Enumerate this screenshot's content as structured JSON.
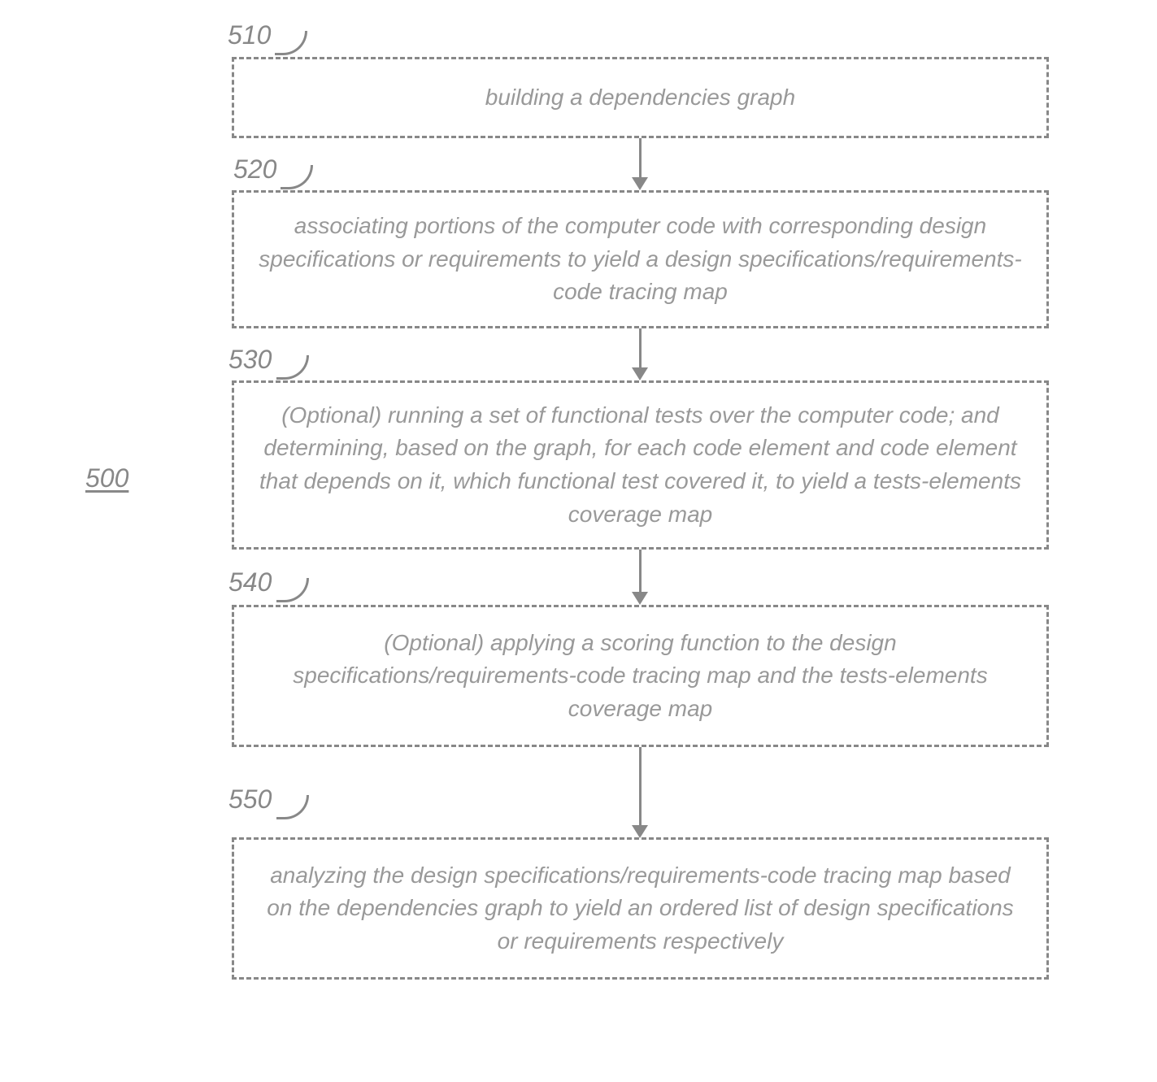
{
  "figure_label": "500",
  "steps": [
    {
      "num": "510",
      "text": "building a dependencies graph"
    },
    {
      "num": "520",
      "text": "associating portions of the computer code with corresponding design specifications or requirements to yield a design specifications/requirements-code tracing map"
    },
    {
      "num": "530",
      "text": "(Optional) running a set of functional tests over the computer code; and determining, based on the graph, for each code element and code element that depends on it, which functional test covered it, to yield a tests-elements coverage map"
    },
    {
      "num": "540",
      "text": "(Optional) applying a scoring function to the design specifications/requirements-code tracing map and the tests-elements coverage map"
    },
    {
      "num": "550",
      "text": "analyzing the design specifications/requirements-code tracing map based on the dependencies graph to yield an ordered list of design specifications or requirements respectively"
    }
  ],
  "chart_data": {
    "type": "flowchart",
    "direction": "top-to-bottom",
    "nodes": [
      {
        "id": "510",
        "label": "building a dependencies graph"
      },
      {
        "id": "520",
        "label": "associating portions of the computer code with corresponding design specifications or requirements to yield a design specifications/requirements-code tracing map"
      },
      {
        "id": "530",
        "label": "(Optional) running a set of functional tests over the computer code; and determining, based on the graph, for each code element and code element that depends on it, which functional test covered it, to yield a tests-elements coverage map",
        "optional": true
      },
      {
        "id": "540",
        "label": "(Optional) applying a scoring function to the design specifications/requirements-code tracing map and the tests-elements coverage map",
        "optional": true
      },
      {
        "id": "550",
        "label": "analyzing the design specifications/requirements-code tracing map based on the dependencies graph to yield an ordered list of design specifications or requirements respectively"
      }
    ],
    "edges": [
      {
        "from": "510",
        "to": "520"
      },
      {
        "from": "520",
        "to": "530"
      },
      {
        "from": "530",
        "to": "540"
      },
      {
        "from": "540",
        "to": "550"
      }
    ]
  }
}
